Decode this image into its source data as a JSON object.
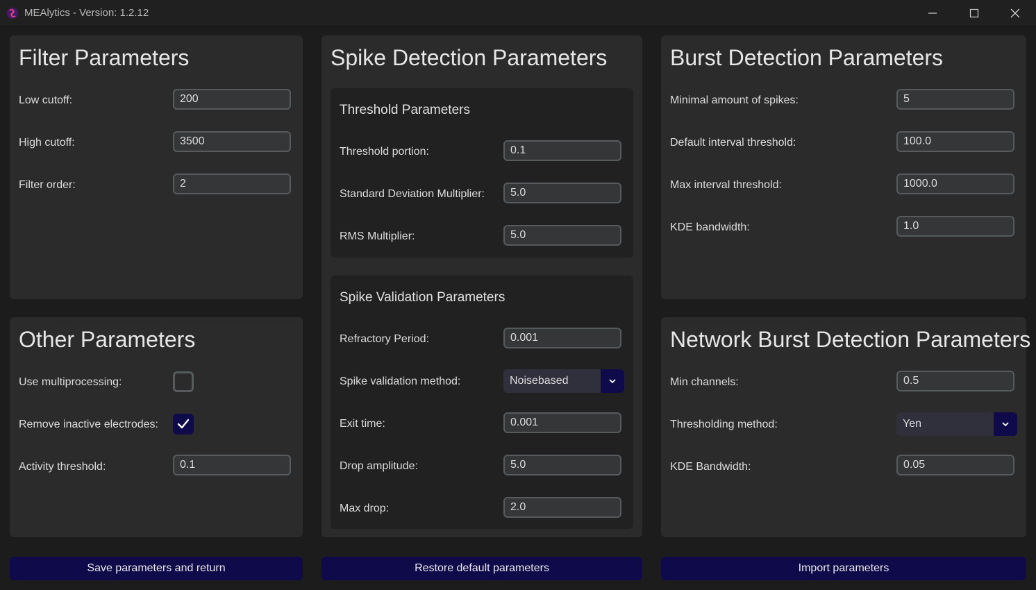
{
  "window": {
    "title": "MEAlytics - Version: 1.2.12",
    "icons": [
      "app-logo-icon",
      "minimize-icon",
      "maximize-icon",
      "close-icon"
    ]
  },
  "filter": {
    "title": "Filter Parameters",
    "low_cutoff_label": "Low cutoff:",
    "low_cutoff_value": "200",
    "high_cutoff_label": "High cutoff:",
    "high_cutoff_value": "3500",
    "order_label": "Filter order:",
    "order_value": "2"
  },
  "other": {
    "title": "Other Parameters",
    "multiprocessing_label": "Use multiprocessing:",
    "multiprocessing_checked": false,
    "remove_inactive_label": "Remove inactive electrodes:",
    "remove_inactive_checked": true,
    "activity_threshold_label": "Activity threshold:",
    "activity_threshold_value": "0.1"
  },
  "spike": {
    "title": "Spike Detection Parameters",
    "threshold": {
      "title": "Threshold Parameters",
      "portion_label": "Threshold portion:",
      "portion_value": "0.1",
      "std_label": "Standard Deviation Multiplier:",
      "std_value": "5.0",
      "rms_label": "RMS Multiplier:",
      "rms_value": "5.0"
    },
    "validation": {
      "title": "Spike Validation Parameters",
      "refractory_label": "Refractory Period:",
      "refractory_value": "0.001",
      "method_label": "Spike validation method:",
      "method_value": "Noisebased",
      "exit_label": "Exit time:",
      "exit_value": "0.001",
      "drop_amp_label": "Drop amplitude:",
      "drop_amp_value": "5.0",
      "max_drop_label": "Max drop:",
      "max_drop_value": "2.0"
    }
  },
  "burst": {
    "title": "Burst Detection Parameters",
    "min_spikes_label": "Minimal amount of spikes:",
    "min_spikes_value": "5",
    "default_interval_label": "Default interval threshold:",
    "default_interval_value": "100.0",
    "max_interval_label": "Max interval threshold:",
    "max_interval_value": "1000.0",
    "kde_label": "KDE bandwidth:",
    "kde_value": "1.0"
  },
  "network": {
    "title": "Network Burst Detection Parameters",
    "min_channels_label": "Min channels:",
    "min_channels_value": "0.5",
    "method_label": "Thresholding method:",
    "method_value": "Yen",
    "kde_label": "KDE Bandwidth:",
    "kde_value": "0.05"
  },
  "buttons": {
    "save": "Save parameters and return",
    "restore": "Restore default parameters",
    "import": "Import parameters"
  },
  "colors": {
    "accent": "#0f0a4a",
    "panel": "#2b2b2b",
    "subpanel": "#212121",
    "background": "#1c1c1c"
  }
}
